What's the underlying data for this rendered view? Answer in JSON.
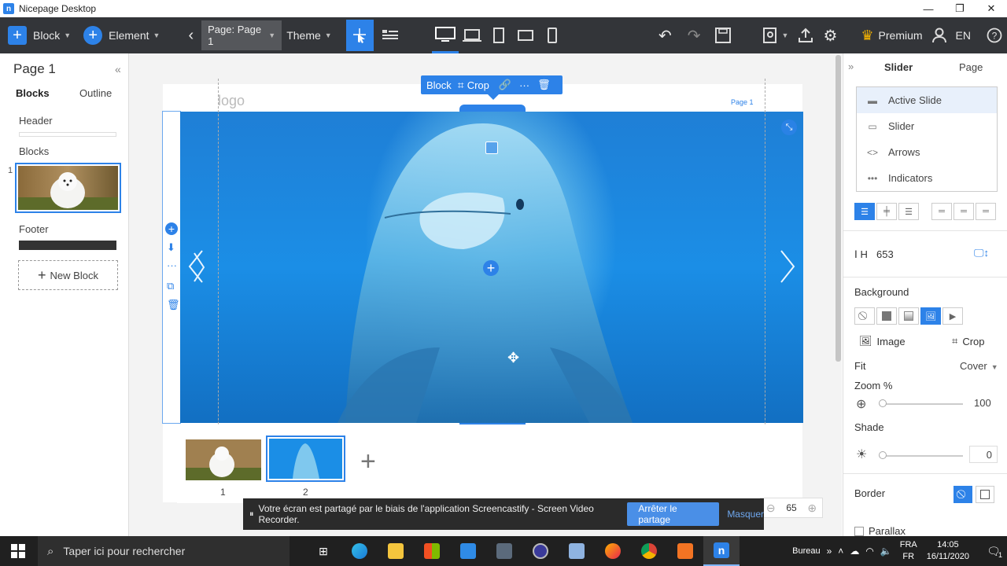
{
  "window": {
    "app_icon": "n",
    "title": "Nicepage Desktop"
  },
  "toolbar": {
    "block_label": "Block",
    "element_label": "Element",
    "page_label": "Page: Page 1",
    "theme_label": "Theme",
    "premium_label": "Premium",
    "lang_label": "EN"
  },
  "left": {
    "title": "Page 1",
    "tab_blocks": "Blocks",
    "tab_outline": "Outline",
    "header_label": "Header",
    "blocks_label": "Blocks",
    "block_index": "1",
    "footer_label": "Footer",
    "new_block": "New Block"
  },
  "canvas": {
    "logo_text": "logo",
    "nav_link": "Page 1",
    "block_tb_block": "Block",
    "block_tb_crop": "Crop",
    "thumb1_num": "1",
    "thumb2_num": "2",
    "zoom_value": "65"
  },
  "right": {
    "tab_slider": "Slider",
    "tab_page": "Page",
    "items": [
      "Active Slide",
      "Slider",
      "Arrows",
      "Indicators"
    ],
    "h_label": "H",
    "h_value": "653",
    "background_label": "Background",
    "image_label": "Image",
    "crop_label": "Crop",
    "fit_label": "Fit",
    "fit_value": "Cover",
    "zoom_label": "Zoom %",
    "zoom_value": "100",
    "shade_label": "Shade",
    "shade_value": "0",
    "border_label": "Border",
    "parallax_label": "Parallax"
  },
  "notification": {
    "text": "Votre écran est partagé par le biais de l'application Screencastify - Screen Video Recorder.",
    "stop": "Arrêter le partage",
    "hide": "Masquer"
  },
  "taskbar": {
    "search_placeholder": "Taper ici pour rechercher",
    "desktop_label": "Bureau",
    "lang_top": "FRA",
    "lang_bottom": "FR",
    "time": "14:05",
    "date": "16/11/2020",
    "notif_count": "1"
  },
  "colors": {
    "accent": "#2d82e8",
    "toolbar_bg": "#333539"
  }
}
